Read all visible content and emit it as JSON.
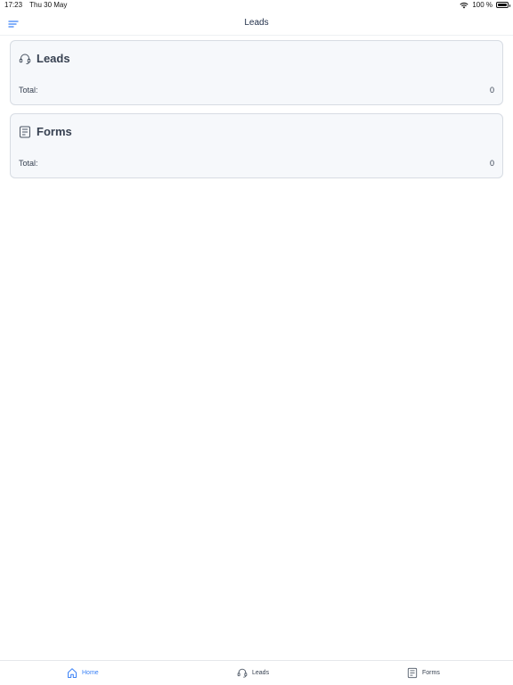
{
  "status": {
    "time": "17:23",
    "date": "Thu 30 May",
    "battery_text": "100 %",
    "battery_level": 1.0
  },
  "header": {
    "title": "Leads",
    "menu_icon": "menu-icon"
  },
  "cards": {
    "leads": {
      "title": "Leads",
      "icon": "headset-icon",
      "total_label": "Total:",
      "total_value": "0"
    },
    "forms": {
      "title": "Forms",
      "icon": "form-icon",
      "total_label": "Total:",
      "total_value": "0"
    }
  },
  "tabs": [
    {
      "label": "Home",
      "icon": "home-icon",
      "active": true
    },
    {
      "label": "Leads",
      "icon": "headset-icon",
      "active": false
    },
    {
      "label": "Forms",
      "icon": "form-icon",
      "active": false
    }
  ],
  "colors": {
    "accent": "#3b82f6",
    "card_bg": "#f6f8fb",
    "card_border": "#d7dce3"
  }
}
